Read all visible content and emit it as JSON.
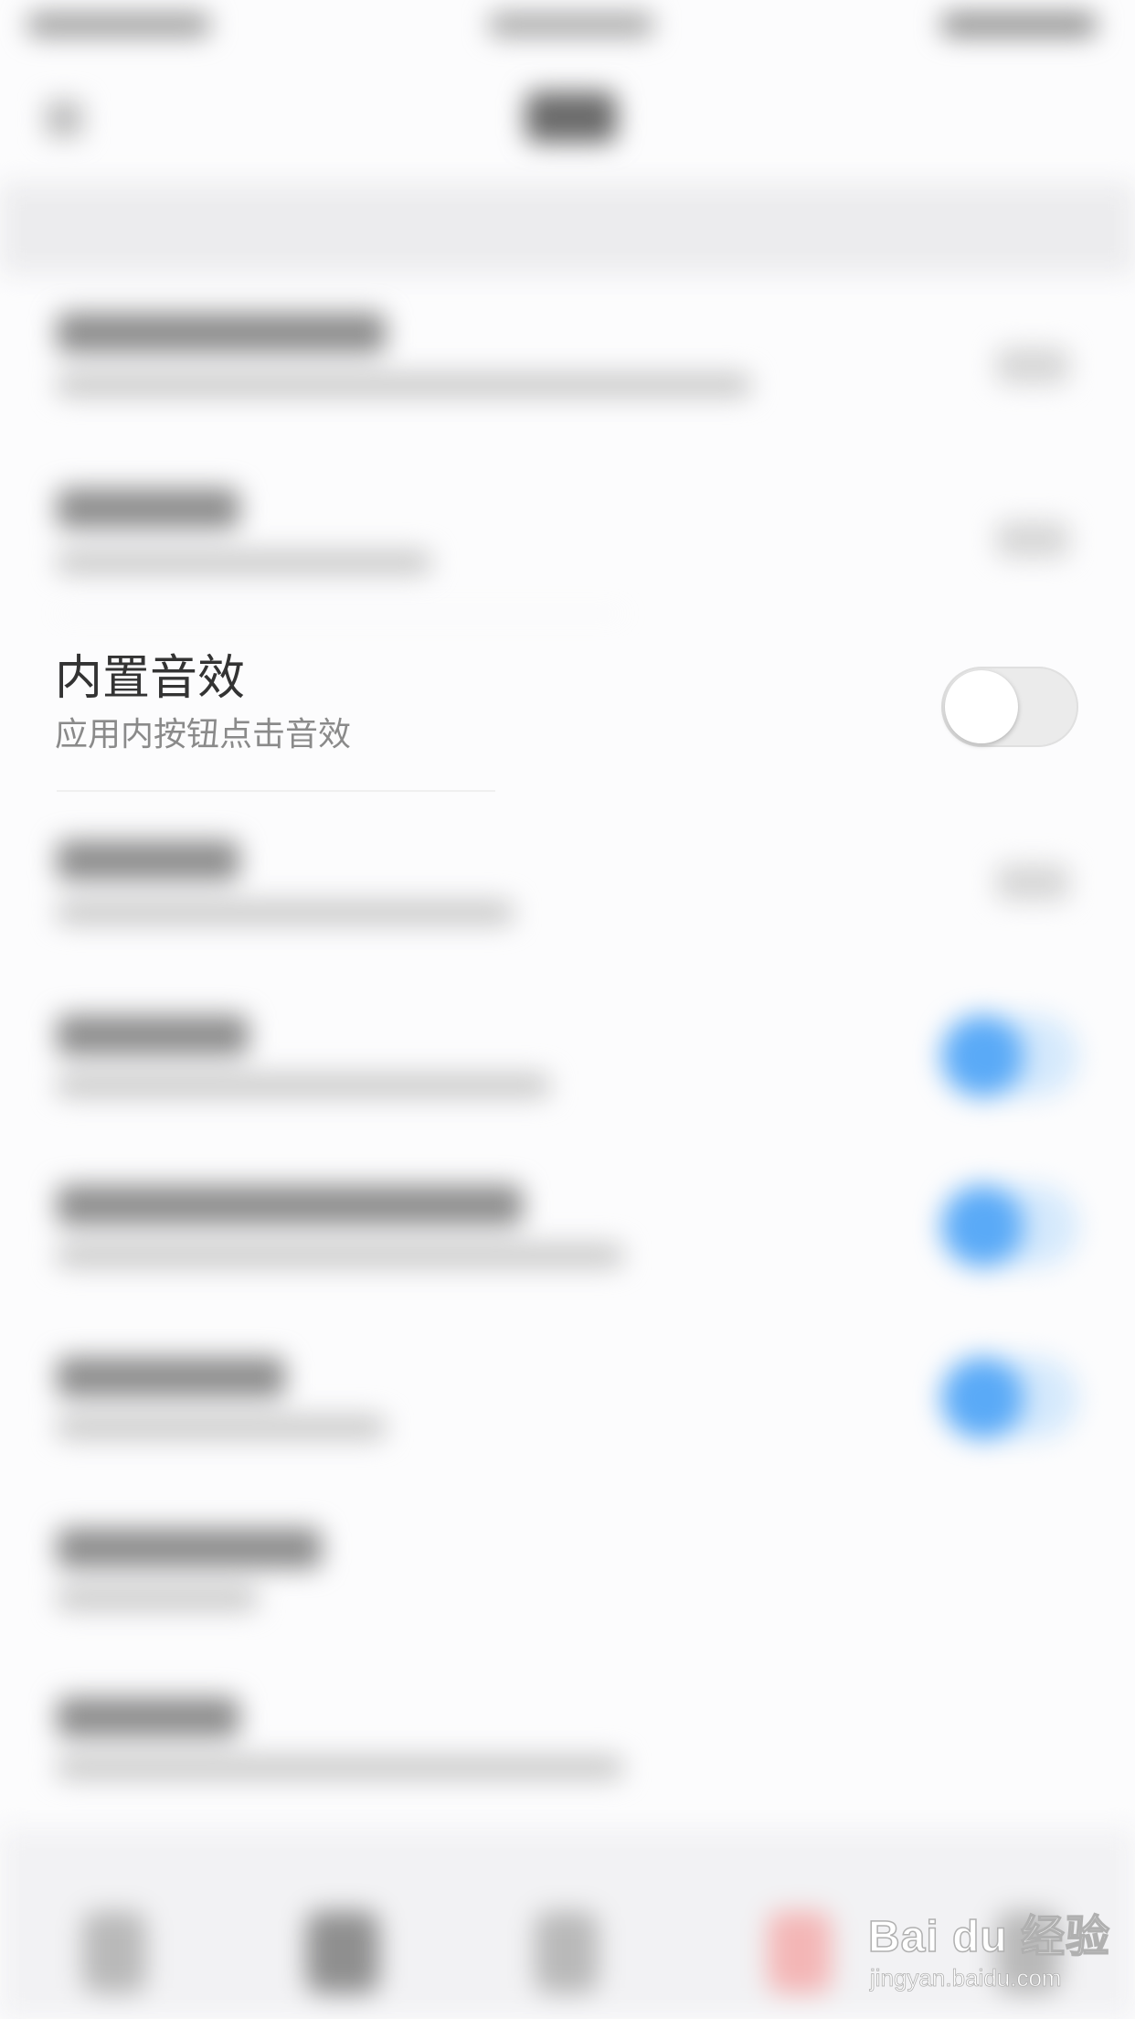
{
  "settings": {
    "focused_item": {
      "title": "内置音效",
      "subtitle": "应用内按钮点击音效",
      "toggle_on": false
    }
  },
  "colors": {
    "accent_blue": "#5aaaf7",
    "toggle_off_track": "#ebebeb",
    "text_primary": "#333333",
    "text_secondary": "#8a8a8a"
  },
  "watermark": {
    "brand": "Bai du 经验",
    "url": "jingyan.baidu.com"
  }
}
